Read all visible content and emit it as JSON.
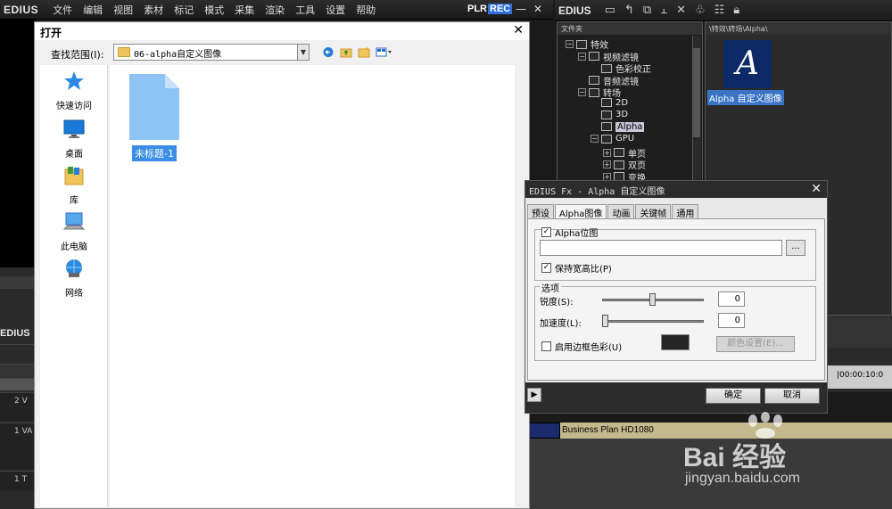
{
  "main": {
    "logo": "EDIUS",
    "menu": [
      "文件",
      "编辑",
      "视图",
      "素材",
      "标记",
      "模式",
      "采集",
      "渲染",
      "工具",
      "设置",
      "帮助"
    ],
    "plr": "PLR",
    "rec": "REC",
    "minimize": "—",
    "close": "✕"
  },
  "bin": {
    "logo": "EDIUS",
    "tree_header": "文件夹",
    "path": "\\特效\\转场\\Alpha\\",
    "tree": [
      {
        "label": "特效",
        "level": 0,
        "expander": "−"
      },
      {
        "label": "视频滤镜",
        "level": 1,
        "expander": "−"
      },
      {
        "label": "色彩校正",
        "level": 2,
        "expander": ""
      },
      {
        "label": "音频滤镜",
        "level": 1,
        "expander": ""
      },
      {
        "label": "转场",
        "level": 1,
        "expander": "−"
      },
      {
        "label": "2D",
        "level": 2,
        "expander": ""
      },
      {
        "label": "3D",
        "level": 2,
        "expander": ""
      },
      {
        "label": "Alpha",
        "level": 2,
        "expander": "",
        "selected": true
      },
      {
        "label": "GPU",
        "level": 2,
        "expander": "−"
      },
      {
        "label": "单页",
        "level": 3,
        "expander": "+"
      },
      {
        "label": "双页",
        "level": 3,
        "expander": "+"
      },
      {
        "label": "变换",
        "level": 3,
        "expander": "+"
      }
    ],
    "thumb_letter": "A",
    "thumb_label": "Alpha 自定义图像"
  },
  "open_dialog": {
    "title": "打开",
    "close": "✕",
    "look_in_label": "查找范围(I):",
    "look_in_value": "06-alpha自定义图像",
    "places": [
      "快速访问",
      "桌面",
      "库",
      "此电脑",
      "网络"
    ],
    "file_name": "未标题-1"
  },
  "fx_dialog": {
    "title": "EDIUS Fx - Alpha 自定义图像",
    "close": "✕",
    "tabs": [
      "预设",
      "Alpha图像",
      "动画",
      "关键帧",
      "通用"
    ],
    "alpha_bitmap_label": "Alpha位图",
    "browse": "...",
    "keep_aspect_label": "保持宽高比(P)",
    "options_label": "选项",
    "sharpness_label": "锐度(S):",
    "sharpness_value": "0",
    "sharpness_fraction": 0.5,
    "accel_label": "加速度(L):",
    "accel_value": "0",
    "accel_fraction": 0.0,
    "border_color_label": "启用边框色彩(U)",
    "color_settings": "颜色设置(E)...",
    "play": "▶",
    "ok": "确定",
    "cancel": "取消"
  },
  "timeline": {
    "logo": "EDIUS",
    "track_labels": [
      "2 V",
      "1 VA",
      "1 T"
    ],
    "ruler_time": "|00:00:10:0",
    "clip_name": "Business Plan HD1080"
  },
  "watermark": {
    "brand": "Bai 经验",
    "url": "jingyan.baidu.com"
  },
  "colors": {
    "accent": "#3a8ee6",
    "rec": "#2f6ed8",
    "track": "#c4b98c"
  }
}
